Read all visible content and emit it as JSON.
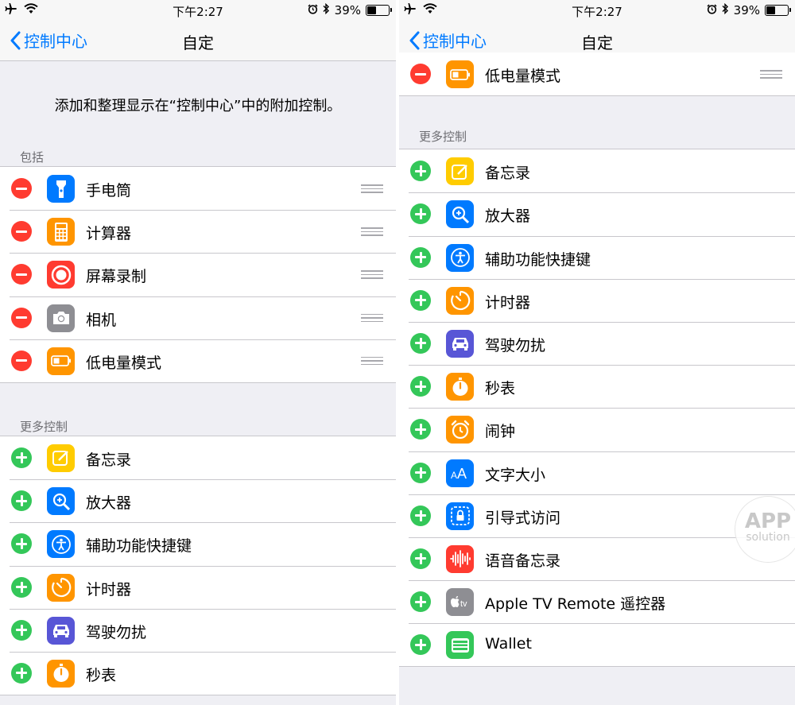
{
  "status": {
    "time": "下午2:27",
    "battery": "39%"
  },
  "nav": {
    "back_label": "控制中心",
    "title": "自定"
  },
  "description": "添加和整理显示在“控制中心”中的附加控制。",
  "included": {
    "header": "包括",
    "items": [
      {
        "label": "手电筒",
        "icon": "flashlight-icon",
        "color": "#007aff"
      },
      {
        "label": "计算器",
        "icon": "calculator-icon",
        "color": "#ff9500"
      },
      {
        "label": "屏幕录制",
        "icon": "screen-record-icon",
        "color": "#ff3b30"
      },
      {
        "label": "相机",
        "icon": "camera-icon",
        "color": "#8e8e93"
      },
      {
        "label": "低电量模式",
        "icon": "battery-icon",
        "color": "#ff9500"
      }
    ]
  },
  "more": {
    "header": "更多控制",
    "items": [
      {
        "label": "备忘录",
        "icon": "notes-icon",
        "color": "#ffcc00"
      },
      {
        "label": "放大器",
        "icon": "magnifier-icon",
        "color": "#007aff"
      },
      {
        "label": "辅助功能快捷键",
        "icon": "accessibility-icon",
        "color": "#007aff"
      },
      {
        "label": "计时器",
        "icon": "timer-icon",
        "color": "#ff9500"
      },
      {
        "label": "驾驶勿扰",
        "icon": "car-icon",
        "color": "#5856d6"
      },
      {
        "label": "秒表",
        "icon": "stopwatch-icon",
        "color": "#ff9500"
      },
      {
        "label": "闹钟",
        "icon": "alarm-icon",
        "color": "#ff9500"
      },
      {
        "label": "文字大小",
        "icon": "text-size-icon",
        "color": "#007aff"
      },
      {
        "label": "引导式访问",
        "icon": "guided-access-icon",
        "color": "#007aff"
      },
      {
        "label": "语音备忘录",
        "icon": "voice-memo-icon",
        "color": "#ff3b30"
      },
      {
        "label": "Apple TV Remote 遥控器",
        "icon": "apple-tv-icon",
        "color": "#8e8e93"
      },
      {
        "label": "Wallet",
        "icon": "wallet-icon",
        "color": "#34c759"
      }
    ]
  },
  "watermark": {
    "line1": "APP",
    "line2": "solution"
  }
}
